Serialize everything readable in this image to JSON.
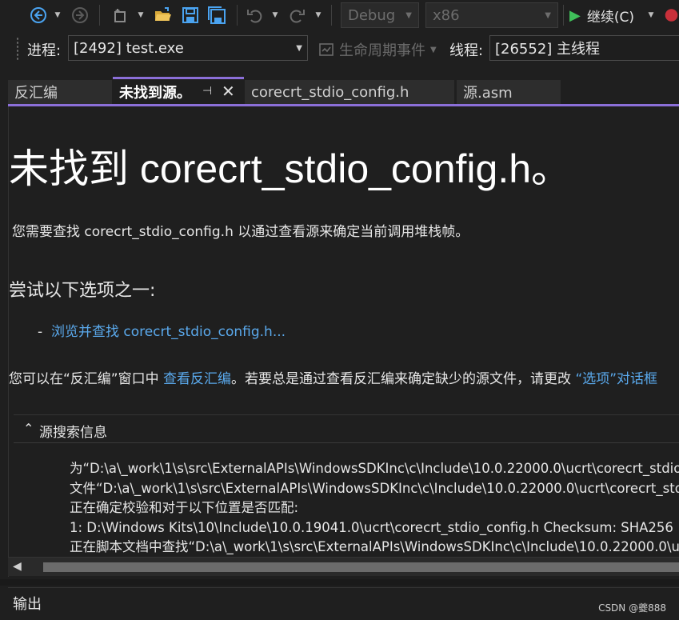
{
  "toolbar": {
    "config_value": "Debug",
    "platform_value": "x86",
    "continue_label": "继续(C)"
  },
  "debug_location": {
    "process_label": "进程:",
    "process_value": "[2492] test.exe",
    "lifecycle_label": "生命周期事件",
    "thread_label": "线程:",
    "thread_value": "[26552] 主线程"
  },
  "tabs": [
    {
      "label": "反汇编"
    },
    {
      "label": "未找到源。"
    },
    {
      "label": "corecrt_stdio_config.h"
    },
    {
      "label": "源.asm"
    }
  ],
  "document": {
    "title": "未找到 corecrt_stdio_config.h。",
    "description": "您需要查找 corecrt_stdio_config.h 以通过查看源来确定当前调用堆栈帧。",
    "options_heading": "尝试以下选项之一:",
    "browse_bullet": "-",
    "browse_link": "浏览并查找 corecrt_stdio_config.h...",
    "disasm_prefix": "您可以在“反汇编”窗口中 ",
    "disasm_link": "查看反汇编",
    "disasm_middle": "。若要总是通过查看反汇编来确定缺少的源文件，请更改 ",
    "options_link": "“选项”对话框",
    "search_info_label": "源搜索信息",
    "search_info_lines": [
      "为“D:\\a\\_work\\1\\s\\src\\ExternalAPIs\\WindowsSDKInc\\c\\Include\\10.0.22000.0\\ucrt\\corecrt_stdio_config.h”定位源。",
      "文件“D:\\a\\_work\\1\\s\\src\\ExternalAPIs\\WindowsSDKInc\\c\\Include\\10.0.22000.0\\ucrt\\corecrt_stdio_config.h”不存在。",
      "正在确定校验和对于以下位置是否匹配:",
      "1: D:\\Windows Kits\\10\\Include\\10.0.19041.0\\ucrt\\corecrt_stdio_config.h Checksum: SHA256",
      "正在脚本文档中查找“D:\\a\\_work\\1\\s\\src\\ExternalAPIs\\WindowsSDKInc\\c\\Include\\10.0.22000.0\\ucrt\\corecrt_stdio_config.h”..."
    ]
  },
  "output_panel": {
    "title": "输出"
  },
  "watermark": "CSDN @夔888"
}
